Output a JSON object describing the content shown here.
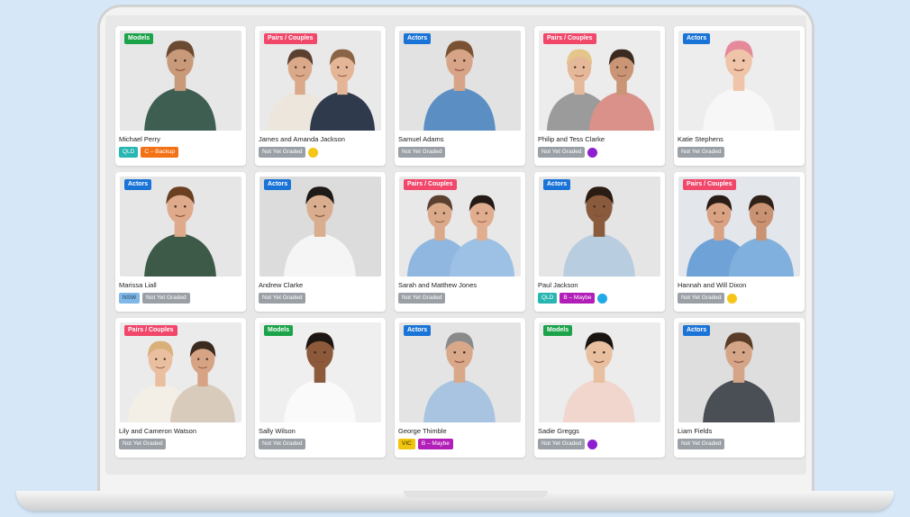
{
  "colors": {
    "Models": "#1ba34a",
    "Actors": "#1a74d8",
    "Pairs / Couples": "#f0476a",
    "grade": "#9aa0a6",
    "region": "#29b6b2",
    "region_vic": "#f1c40f",
    "grade_c": "#f47216",
    "grade_b": "#b21fb8",
    "dot_yellow": "#f5c518",
    "dot_purple": "#8e1fd0",
    "dot_blue": "#21a9e6"
  },
  "cards": [
    {
      "name": "Michael Perry",
      "category": "Models",
      "bg": "#e7e7e7",
      "people": [
        {
          "skin": "#c99a7a",
          "hair": "#6b4a32",
          "shirt": "#3f5e52"
        }
      ],
      "tags": [
        {
          "text": "QLD",
          "kind": "region"
        },
        {
          "text": "C – Backup",
          "kind": "grade_c"
        }
      ]
    },
    {
      "name": "James and Amanda Jackson",
      "category": "Pairs / Couples",
      "bg": "#e9e9e9",
      "people": [
        {
          "skin": "#d9a98a",
          "hair": "#5a4030",
          "shirt": "#ece6dc"
        },
        {
          "skin": "#e4b596",
          "hair": "#8a6444",
          "shirt": "#2f3b4d"
        }
      ],
      "tags": [
        {
          "text": "Not Yet Graded",
          "kind": "grade"
        },
        {
          "dot": "dot_yellow"
        }
      ]
    },
    {
      "name": "Samuel Adams",
      "category": "Actors",
      "bg": "#e2e2e2",
      "people": [
        {
          "skin": "#d7a487",
          "hair": "#7a5233",
          "shirt": "#5b8fc4"
        }
      ],
      "tags": [
        {
          "text": "Not Yet Graded",
          "kind": "grade"
        }
      ]
    },
    {
      "name": "Philip and Tess Clarke",
      "category": "Pairs / Couples",
      "bg": "#ececec",
      "people": [
        {
          "skin": "#e5b899",
          "hair": "#e4c58a",
          "shirt": "#9b9b9b"
        },
        {
          "skin": "#c99575",
          "hair": "#3a2a1f",
          "shirt": "#d9918a"
        }
      ],
      "tags": [
        {
          "text": "Not Yet Graded",
          "kind": "grade"
        },
        {
          "dot": "dot_purple"
        }
      ]
    },
    {
      "name": "Katie Stephens",
      "category": "Actors",
      "bg": "#ededed",
      "people": [
        {
          "skin": "#efc4a8",
          "hair": "#e58a9a",
          "shirt": "#f7f7f7"
        }
      ],
      "tags": [
        {
          "text": "Not Yet Graded",
          "kind": "grade"
        }
      ]
    },
    {
      "name": "Marissa Liall",
      "category": "Actors",
      "bg": "#e6e6e6",
      "people": [
        {
          "skin": "#dfaa8b",
          "hair": "#6a3f22",
          "shirt": "#3c5a47"
        }
      ],
      "tags": [
        {
          "text": "NSW",
          "kind": "region_nsw"
        },
        {
          "text": "Not Yet Graded",
          "kind": "grade"
        }
      ]
    },
    {
      "name": "Andrew Clarke",
      "category": "Actors",
      "bg": "#dcdcdc",
      "people": [
        {
          "skin": "#d9ae8f",
          "hair": "#1d1a18",
          "shirt": "#f5f5f5"
        }
      ],
      "tags": [
        {
          "text": "Not Yet Graded",
          "kind": "grade"
        }
      ]
    },
    {
      "name": "Sarah and Matthew Jones",
      "category": "Pairs / Couples",
      "bg": "#e8e8e8",
      "people": [
        {
          "skin": "#d9a98a",
          "hair": "#5b4030",
          "shirt": "#8fb7df"
        },
        {
          "skin": "#e0ad8e",
          "hair": "#241a15",
          "shirt": "#9cc1e5"
        }
      ],
      "tags": [
        {
          "text": "Not Yet Graded",
          "kind": "grade"
        }
      ]
    },
    {
      "name": "Paul Jackson",
      "category": "Actors",
      "bg": "#e5e5e5",
      "people": [
        {
          "skin": "#8a5a3c",
          "hair": "#2a1c13",
          "shirt": "#b8cde0"
        }
      ],
      "tags": [
        {
          "text": "QLD",
          "kind": "region"
        },
        {
          "text": "B – Maybe",
          "kind": "grade_b"
        },
        {
          "dot": "dot_blue"
        }
      ]
    },
    {
      "name": "Hannah and Will Dixon",
      "category": "Pairs / Couples",
      "bg": "#e3e6ea",
      "people": [
        {
          "skin": "#d8a283",
          "hair": "#2a1d15",
          "shirt": "#6fa2d6"
        },
        {
          "skin": "#c99373",
          "hair": "#2f2118",
          "shirt": "#7fb0de"
        }
      ],
      "tags": [
        {
          "text": "Not Yet Graded",
          "kind": "grade"
        },
        {
          "dot": "dot_yellow"
        }
      ]
    },
    {
      "name": "Lily and Cameron Watson",
      "category": "Pairs / Couples",
      "bg": "#ebebeb",
      "people": [
        {
          "skin": "#eabfa0",
          "hair": "#d9b07a",
          "shirt": "#f3eee6"
        },
        {
          "skin": "#d6a485",
          "hair": "#3b2a1e",
          "shirt": "#d8cbbb"
        }
      ],
      "tags": [
        {
          "text": "Not Yet Graded",
          "kind": "grade"
        }
      ]
    },
    {
      "name": "Sally Wilson",
      "category": "Models",
      "bg": "#efefef",
      "people": [
        {
          "skin": "#8c5a3a",
          "hair": "#1e1612",
          "shirt": "#fafafa"
        }
      ],
      "tags": [
        {
          "text": "Not Yet Graded",
          "kind": "grade"
        }
      ]
    },
    {
      "name": "George Thimble",
      "category": "Actors",
      "bg": "#e4e4e4",
      "people": [
        {
          "skin": "#d8a889",
          "hair": "#8a8a8a",
          "shirt": "#a8c4e0"
        }
      ],
      "tags": [
        {
          "text": "VIC",
          "kind": "region_vic"
        },
        {
          "text": "B – Maybe",
          "kind": "grade_b"
        }
      ]
    },
    {
      "name": "Sadie Greggs",
      "category": "Models",
      "bg": "#ececec",
      "people": [
        {
          "skin": "#e8c0a0",
          "hair": "#1a1411",
          "shirt": "#f1d6ce"
        }
      ],
      "tags": [
        {
          "text": "Not Yet Graded",
          "kind": "grade"
        },
        {
          "dot": "dot_purple"
        }
      ]
    },
    {
      "name": "Liam Fields",
      "category": "Actors",
      "bg": "#dedede",
      "people": [
        {
          "skin": "#d5a588",
          "hair": "#5a3d28",
          "shirt": "#4a4f55"
        }
      ],
      "tags": [
        {
          "text": "Not Yet Graded",
          "kind": "grade"
        }
      ]
    }
  ]
}
